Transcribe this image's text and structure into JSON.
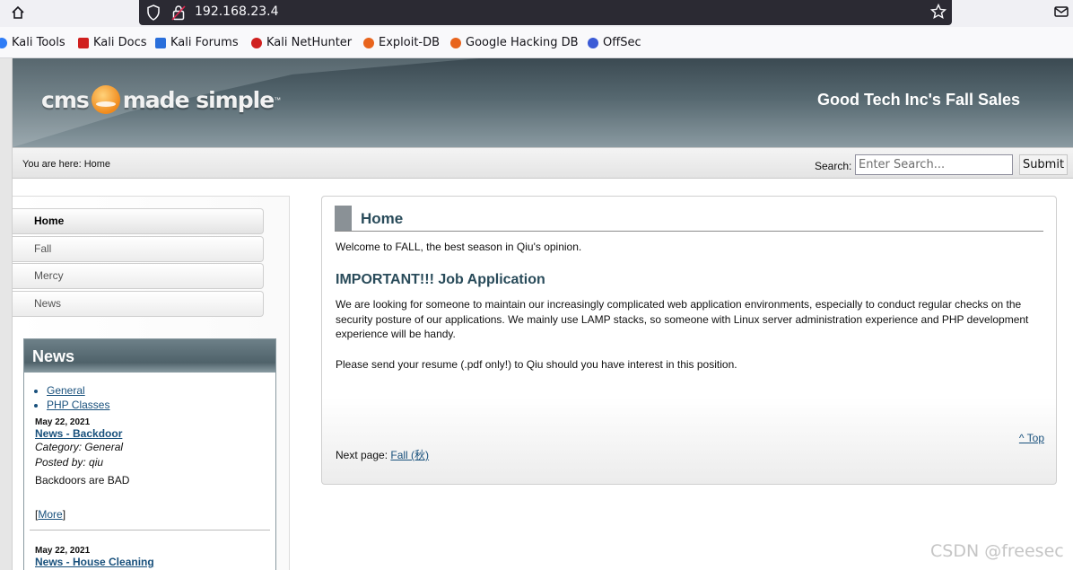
{
  "browser": {
    "url": "192.168.23.4",
    "bookmarks": [
      {
        "label": "Kali Tools",
        "icon": "kali-tools-icon",
        "color": "#2f7cf6"
      },
      {
        "label": "Kali Docs",
        "icon": "kali-docs-icon",
        "color": "#d0201f"
      },
      {
        "label": "Kali Forums",
        "icon": "kali-forums-icon",
        "color": "#2a6fdb"
      },
      {
        "label": "Kali NetHunter",
        "icon": "kali-nethunter-icon",
        "color": "#d0201f"
      },
      {
        "label": "Exploit-DB",
        "icon": "exploit-db-icon",
        "color": "#e8641d"
      },
      {
        "label": "Google Hacking DB",
        "icon": "google-hacking-db-icon",
        "color": "#e8641d"
      },
      {
        "label": "OffSec",
        "icon": "offsec-icon",
        "color": "#3b5bd6"
      }
    ]
  },
  "header": {
    "logo_text": "cms made simple",
    "logo_tm": "™",
    "site_title": "Good Tech Inc's Fall Sales"
  },
  "crumbbar": {
    "breadcrumb": "You are here: Home",
    "search_label": "Search:",
    "search_placeholder": "Enter Search...",
    "submit_label": "Submit"
  },
  "sidebar": {
    "menu": [
      {
        "label": "Home",
        "active": true
      },
      {
        "label": "Fall",
        "active": false
      },
      {
        "label": "Mercy",
        "active": false
      },
      {
        "label": "News",
        "active": false
      }
    ],
    "news": {
      "heading": "News",
      "categories": [
        "General",
        "PHP Classes"
      ],
      "items": [
        {
          "date": "May 22, 2021",
          "title": "News - Backdoor",
          "category": "Category: General",
          "posted_by": "Posted by: qiu",
          "body": "Backdoors are BAD",
          "more": "More"
        },
        {
          "date": "May 22, 2021",
          "title": "News - House Cleaning"
        }
      ]
    }
  },
  "main": {
    "title": "Home",
    "welcome": "Welcome to FALL, the best season in Qiu's opinion.",
    "job_title": "IMPORTANT!!! Job Application",
    "job_text": "We are looking for someone to maintain our increasingly complicated web application environments, especially to conduct regular checks on the security posture of our applications. We mainly use LAMP stacks, so someone with Linux server administration experience and PHP development experience will be handy.",
    "job_send": "Please send your resume (.pdf only!) to Qiu should you have interest in this position.",
    "top_link": "^ Top",
    "next_page_label": "Next page:",
    "next_page_link": "Fall (秋)"
  },
  "watermark": "CSDN @freesec"
}
